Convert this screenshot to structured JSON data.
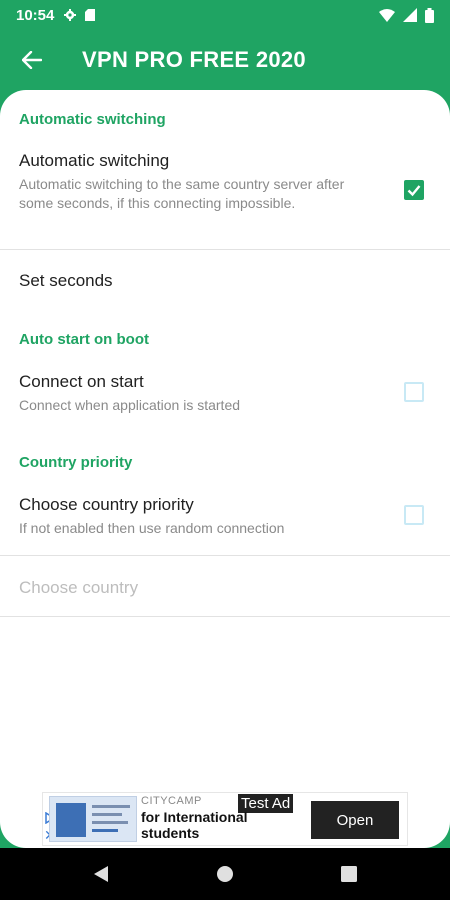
{
  "status_bar": {
    "time": "10:54",
    "icons": [
      "settings-icon",
      "sd-card-icon",
      "wifi-icon",
      "signal-icon",
      "battery-icon"
    ]
  },
  "app_bar": {
    "title": "VPN PRO FREE 2020",
    "back_icon": "arrow-back-icon"
  },
  "settings": {
    "cat1": "Automatic switching",
    "auto_switch": {
      "title": "Automatic switching",
      "summary": "Automatic switching to the same country server after some seconds, if this connecting impossible.",
      "checked": true
    },
    "set_seconds": {
      "title": "Set seconds"
    },
    "cat2": "Auto start on boot",
    "connect_on_start": {
      "title": "Connect on start",
      "summary": "Connect when application is started",
      "checked": false
    },
    "cat3": "Country priority",
    "country_priority": {
      "title": "Choose country priority",
      "summary": "If not enabled then use random connection",
      "checked": false
    },
    "choose_country": {
      "title": "Choose country",
      "enabled": false
    }
  },
  "ad": {
    "brand": "CITYCAMP",
    "tag": "Test Ad",
    "text_line1": "for International",
    "text_line2": "students",
    "button": "Open"
  },
  "colors": {
    "accent": "#1fa463",
    "checkbox_off": "#c8e9f5",
    "text": "#212121",
    "summary": "#8a8a8a"
  }
}
